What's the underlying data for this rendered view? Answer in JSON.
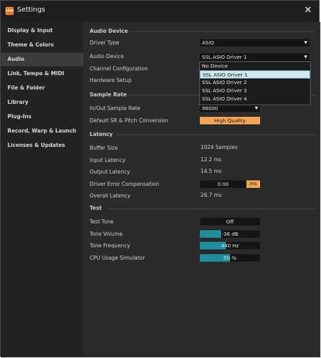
{
  "window": {
    "title": "Settings",
    "app_icon_text": "Live",
    "close_glyph": "✕"
  },
  "sidebar": {
    "items": [
      {
        "label": "Display & Input"
      },
      {
        "label": "Theme & Colors"
      },
      {
        "label": "Audio",
        "active": true
      },
      {
        "label": "Link, Tempo & MIDI"
      },
      {
        "label": "File & Folder"
      },
      {
        "label": "Library"
      },
      {
        "label": "Plug-Ins"
      },
      {
        "label": "Record, Warp & Launch"
      },
      {
        "label": "Licenses & Updates"
      }
    ]
  },
  "audio_device": {
    "section": "Audio Device",
    "driver_type_label": "Driver Type",
    "driver_type_value": "ASIO",
    "audio_device_label": "Audio Device",
    "audio_device_value": "SSL ASIO Driver 1",
    "channel_config_label": "Channel Configuration",
    "hardware_setup_label": "Hardware Setup",
    "dropdown_options": [
      "No Device",
      "SSL ASIO Driver 1",
      "SSL ASIO Driver 2",
      "SSL ASIO Driver 3",
      "SSL ASIO Driver 4"
    ],
    "dropdown_selected": "SSL ASIO Driver 1"
  },
  "sample_rate": {
    "section": "Sample Rate",
    "in_out_label": "In/Out Sample Rate",
    "in_out_value": "96000",
    "default_sr_label": "Default SR & Pitch Conversion",
    "default_sr_value": "High Quality"
  },
  "latency": {
    "section": "Latency",
    "buffer_size_label": "Buffer Size",
    "buffer_size_value": "1024 Samples",
    "input_latency_label": "Input Latency",
    "input_latency_value": "12.2 ms",
    "output_latency_label": "Output Latency",
    "output_latency_value": "14.5 ms",
    "driver_error_label": "Driver Error Compensation",
    "driver_error_value": "0.00",
    "driver_error_unit": "ms",
    "overall_latency_label": "Overall Latency",
    "overall_latency_value": "26.7 ms"
  },
  "test": {
    "section": "Test",
    "test_tone_label": "Test Tone",
    "test_tone_value": "Off",
    "tone_volume_label": "Tone Volume",
    "tone_volume_value": "-36 dB",
    "tone_volume_fill": 0.35,
    "tone_frequency_label": "Tone Frequency",
    "tone_frequency_value": "440 Hz",
    "tone_frequency_fill": 0.43,
    "cpu_label": "CPU Usage Simulator",
    "cpu_value": "50 %",
    "cpu_fill": 0.5
  },
  "colors": {
    "accent_orange": "#f5a455",
    "slider_teal": "#1f8fa0",
    "dropdown_highlight": "#cfe7f0"
  }
}
